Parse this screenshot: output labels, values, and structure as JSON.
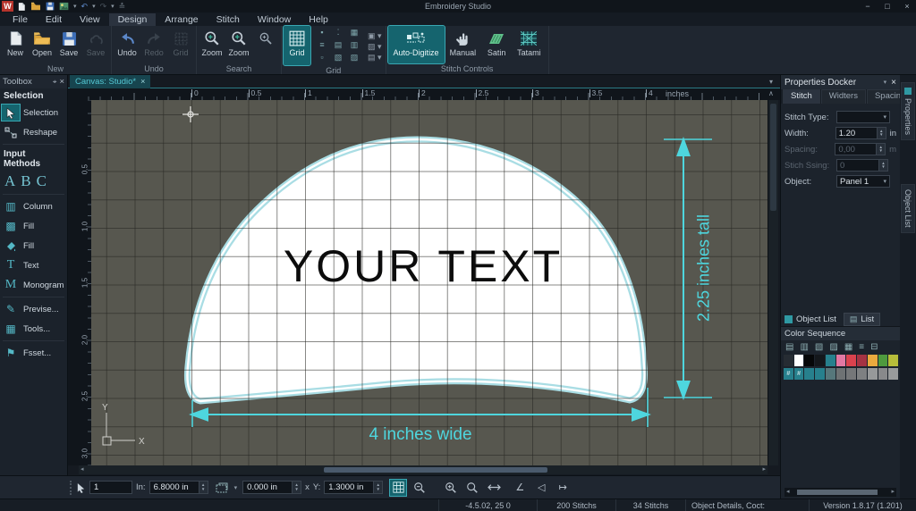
{
  "window": {
    "title": "Embroidery Studio",
    "logo": "W",
    "minimize": "−",
    "maximize": "□",
    "close": "×"
  },
  "menubar": {
    "items": [
      "File",
      "Edit",
      "View",
      "Design",
      "Arrange",
      "Stitch",
      "Window",
      "Help"
    ],
    "active_index": 3
  },
  "ribbon": {
    "groups": [
      {
        "label": "New"
      },
      {
        "label": "Undo"
      },
      {
        "label": "Search"
      },
      {
        "label": "Grid"
      },
      {
        "label": "Stitch Controls"
      }
    ],
    "buttons": {
      "new": "New",
      "open": "Open",
      "save": "Save",
      "save2": "Save",
      "undo": "Undo",
      "redo": "Redo",
      "grid_small": "Grid",
      "zoom1": "Zoom",
      "zoom2": "Zoom",
      "grid": "Grid",
      "auto_digitize": "Auto-Digitize",
      "manual": "Manual",
      "satin": "Satin",
      "tatami": "Tatami"
    }
  },
  "toolbox": {
    "title": "Toolbox",
    "selection_header": "Selection",
    "selection": "Selection",
    "reshape": "Reshape",
    "input_header": "Input Methods",
    "abc": [
      "A",
      "B",
      "C"
    ],
    "column": "Column",
    "fill1": "Fill",
    "fill2": "Fill",
    "text": "Text",
    "monogram": "Monogram",
    "previse": "Previse...",
    "tools": "Tools...",
    "fsset": "Fsset..."
  },
  "canvas": {
    "tab": "Canvas: Studio*",
    "h_ruler": [
      "0",
      "0.5",
      "1",
      "1.5",
      "2",
      "2.5",
      "3",
      "3.5",
      "4"
    ],
    "unit": "inches",
    "v_ruler": [
      "0.5",
      "1.0",
      "1.5",
      "2.0",
      "2.5",
      "3.0"
    ],
    "design_text": "YOUR TEXT",
    "dim_tall": "2.25 inches tall",
    "dim_wide": "4 inches wide",
    "axis_x": "X",
    "axis_y": "Y",
    "canvas_bg": "#57574f",
    "dim_color": "#4ed6de",
    "shape_outline": "#a9dde4"
  },
  "properties": {
    "title": "Properties Docker",
    "tabs": [
      "Stitch",
      "Widters",
      "Spacing"
    ],
    "active_tab_index": 0,
    "stitch_type_label": "Stitch Type:",
    "width_label": "Width:",
    "width_value": "1.20",
    "width_unit": "in",
    "spacing_label": "Spacing:",
    "spacing_value": "0,00",
    "spacing_unit": "m",
    "stich_ssing_label": "Stich Ssing:",
    "stich_ssing_value": "0",
    "object_label": "Object:",
    "object_value": "Panel 1",
    "object_list_tab": "Object List",
    "list_tab": "List",
    "color_sequence_title": "Color Sequence",
    "palette_tool_icons": [
      {
        "name": "design-thumb-icon",
        "glyph": "▤"
      },
      {
        "name": "copy-icon",
        "glyph": "▥"
      },
      {
        "name": "paste-icon",
        "glyph": "▧"
      },
      {
        "name": "cycle-colors-icon",
        "glyph": "▨"
      },
      {
        "name": "layers-icon",
        "glyph": "▦"
      },
      {
        "name": "list-view-icon",
        "glyph": "≡"
      },
      {
        "name": "compact-view-icon",
        "glyph": "⊟"
      }
    ],
    "palette_row1": [
      "#262c33",
      "#ffffff",
      "#060708",
      "#14171b",
      "#27808d",
      "#e378a3",
      "#da424e",
      "#a53343",
      "#eaa93e",
      "#4e9a3e",
      "#b7bd3a"
    ],
    "palette_row2": [
      "#27808d",
      "#27808d",
      "#27808d",
      "#27808d",
      "#56777b",
      "#6e7274",
      "#757779",
      "#7e8082",
      "#97999a",
      "#88898b",
      "#999b9c"
    ],
    "palette_row2_glyphs": [
      "#",
      "#",
      "",
      "",
      "",
      "",
      "",
      "",
      "",
      "",
      ""
    ]
  },
  "side_tabs": [
    "Properties",
    "Object List"
  ],
  "coordbar": {
    "count": "1",
    "in_label": "In:",
    "in_value": "6.8000 in",
    "offset_value": "0.000 in",
    "x_label": "x",
    "y_label": "Y:",
    "y_value": "1.3000 in",
    "icons": [
      "grid-toggle",
      "zoom-out",
      "zoom-in",
      "zoom",
      "pan",
      "measure",
      "speaker",
      "jump"
    ]
  },
  "statusbar": {
    "coords": "-4.5.02, 25 0",
    "stitches_total": "200 Stitchs",
    "stitches_selected": "34 Stitchs",
    "object_details": "Object Details, Coct:",
    "version": "Version 1.8.17 (1.201)"
  },
  "accent_color": "#2f99a3"
}
